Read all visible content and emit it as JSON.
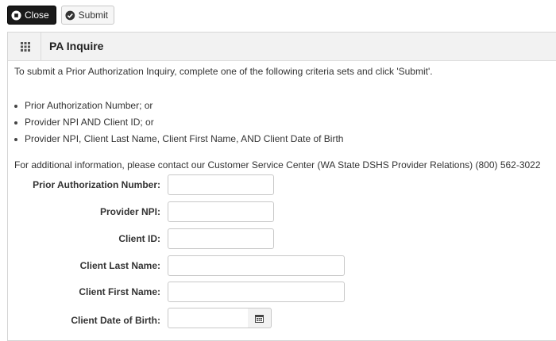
{
  "toolbar": {
    "close_label": "Close",
    "submit_label": "Submit"
  },
  "panel": {
    "title": "PA Inquire",
    "instructions": "To submit a Prior Authorization Inquiry, complete one of the following criteria sets and click 'Submit'.",
    "criteria": [
      "Prior Authorization Number; or",
      "Provider NPI AND Client ID; or",
      "Provider NPI, Client Last Name, Client First Name, AND Client Date of Birth"
    ],
    "contact": "For additional information, please contact our Customer Service Center (WA State DSHS Provider Relations) (800) 562-3022"
  },
  "form": {
    "fields": [
      {
        "label": "Prior Authorization Number:",
        "value": ""
      },
      {
        "label": "Provider NPI:",
        "value": ""
      },
      {
        "label": "Client ID:",
        "value": ""
      },
      {
        "label": "Client Last Name:",
        "value": ""
      },
      {
        "label": "Client First Name:",
        "value": ""
      },
      {
        "label": "Client Date of Birth:",
        "value": ""
      }
    ]
  },
  "icons": {
    "close": "close-icon",
    "submit": "check-circle-icon",
    "menu": "grid-icon",
    "calendar": "calendar-icon"
  }
}
